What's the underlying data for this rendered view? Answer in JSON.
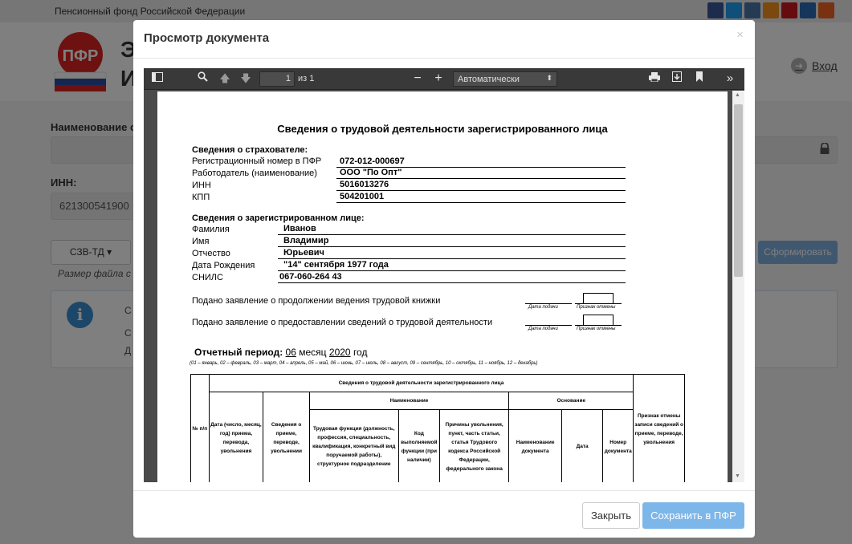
{
  "background": {
    "org_name": "Пенсионный фонд Российской Федерации",
    "logo_text": "ПФР",
    "logo_letters": [
      "Э",
      "И"
    ],
    "login_label": "Вход",
    "label_name": "Наименование ст",
    "label_inn": "ИНН:",
    "inn_value": "621300541900",
    "form_select": "СЗВ-ТД ▾",
    "form_button": "Сформировать",
    "file_size_note": "Размер файла с о",
    "info_fragments": [
      "С",
      "С",
      "Д"
    ]
  },
  "modal": {
    "title": "Просмотр документа",
    "close_symbol": "×",
    "buttons": {
      "close": "Закрыть",
      "save": "Сохранить в ПФР"
    }
  },
  "viewer": {
    "page_current": "1",
    "page_total": "из 1",
    "zoom": "Автоматически"
  },
  "document": {
    "title": "Сведения о трудовой деятельности зарегистрированного лица",
    "insurer": {
      "heading": "Сведения о страхователе:",
      "rows": [
        {
          "label": "Регистрационный номер в ПФР",
          "value": "072-012-000697"
        },
        {
          "label": "Работодатель (наименование)",
          "value": "ООО \"По Опт\""
        },
        {
          "label": "ИНН",
          "value": "5016013276"
        },
        {
          "label": "КПП",
          "value": "504201001"
        }
      ]
    },
    "person": {
      "heading": "Сведения о зарегистрированном лице:",
      "rows": [
        {
          "label": "Фамилия",
          "value": "Иванов"
        },
        {
          "label": "Имя",
          "value": "Владимир"
        },
        {
          "label": "Отчество",
          "value": "Юрьевич"
        },
        {
          "label": "Дата Рождения",
          "value": "\"14\" сентября 1977 года"
        },
        {
          "label": "СНИЛС",
          "value": "067-060-264 43"
        }
      ]
    },
    "statements": {
      "continue_book": "Подано заявление о продолжении ведения трудовой книжки",
      "provide_info": "Подано заявление о предоставлении сведений о трудовой деятельности",
      "date_caption": "Дата подачи",
      "cancel_caption": "Признак отмены"
    },
    "period": {
      "label": "Отчетный период:",
      "month_value": "06",
      "month_label": "месяц",
      "year_value": "2020",
      "year_label": "год",
      "months_hint": "(01 – январь, 02 – февраль, 03 – март, 04 – апрель, 05 – май, 06 – июнь, 07 – июль, 08 – август, 09 – сентябрь, 10 – октябрь, 11 – ноябрь, 12 – декабрь)"
    },
    "table": {
      "header_main": "Сведения о трудовой деятельности зарегистрированного лица",
      "col_num": "№ п/п",
      "col_date": "Дата (число, месяц, год) приема, перевода, увольнения",
      "col_event": "Сведения о приеме, переводе, увольнении",
      "group_name": "Наименование",
      "col_function": "Трудовая функция (должность, профессия, специальность, квалификация, конкретный вид поручаемой работы), структурное подразделение",
      "col_code": "Код выполняемой функции (при наличии)",
      "col_reason": "Причины увольнения, пункт, часть статьи, статья Трудового кодекса Российской Федерации, федерального закона",
      "group_basis": "Основание",
      "col_doc_name": "Наименование документа",
      "col_doc_date": "Дата",
      "col_doc_num": "Номер документа",
      "col_cancel": "Признак отмены записи сведений о приеме, переводе, увольнения"
    }
  }
}
